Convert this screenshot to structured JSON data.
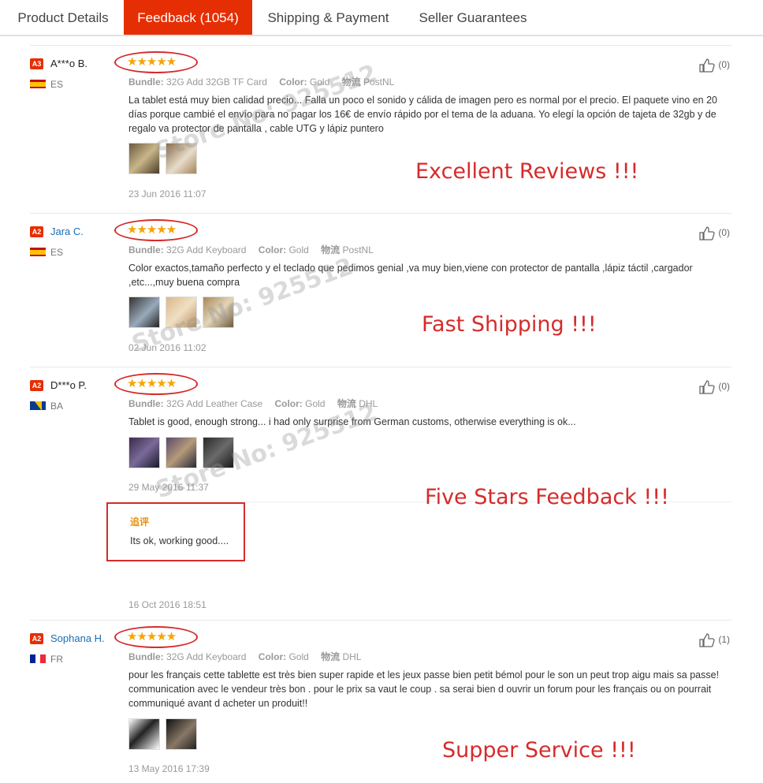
{
  "tabs": [
    {
      "label": "Product Details"
    },
    {
      "label": "Feedback (1054)"
    },
    {
      "label": "Shipping & Payment"
    },
    {
      "label": "Seller Guarantees"
    }
  ],
  "watermark": "Store No: 925512",
  "labels": {
    "bundle": "Bundle:",
    "color": "Color:",
    "logistics": "物流",
    "stars": "★★★★★"
  },
  "reviews": [
    {
      "level": "A3",
      "name": "A***o B.",
      "country": "ES",
      "bundle": "32G Add 32GB TF Card",
      "color": "Gold",
      "shipping": "PostNL",
      "text": "La tablet está muy bien calidad precio... Falla un poco el sonido y cálida de imagen pero es normal por el precio. El paquete vino en 20 días porque cambié el envío para no pagar los 16€ de envío rápido por el tema de la aduana. Yo elegí la opción de tajeta de 32gb y de regalo va protector de pantalla , cable UTG y lápiz puntero",
      "date": "23 Jun 2016 11:07",
      "likes": "(0)",
      "promo": "Excellent Reviews !!!"
    },
    {
      "level": "A2",
      "name": "Jara C.",
      "country": "ES",
      "bundle": "32G Add Keyboard",
      "color": "Gold",
      "shipping": "PostNL",
      "text": "Color exactos,tamaño perfecto y el teclado que pedimos genial ,va muy bien,viene con protector de pantalla ,lápiz táctil ,cargador ,etc...,muy buena compra",
      "date": "02 Jun 2016 11:02",
      "likes": "(0)",
      "promo": "Fast Shipping !!!"
    },
    {
      "level": "A2",
      "name": "D***o P.",
      "country": "BA",
      "bundle": "32G Add Leather Case",
      "color": "Gold",
      "shipping": "DHL",
      "text": "Tablet is good, enough strong... i had only surprise from German customs, otherwise everything is ok...",
      "date": "29 May 2016 11:37",
      "likes": "(0)",
      "promo": "Five Stars Feedback !!!",
      "followup": {
        "title": "追评",
        "text": "Its ok, working good....",
        "date": "16 Oct 2016 18:51"
      }
    },
    {
      "level": "A2",
      "name": "Sophana H.",
      "country": "FR",
      "bundle": "32G Add Keyboard",
      "color": "Gold",
      "shipping": "DHL",
      "text": "pour les français cette tablette est très bien super rapide et les jeux passe bien petit bémol pour le son un peut trop aigu mais sa passe! communication avec le vendeur très bon . pour le prix sa vaut le coup . sa serai bien d ouvrir un forum pour les français ou on pourrait communiqué avant d acheter un produit!!",
      "date": "13 May 2016 17:39",
      "likes": "(1)",
      "promo": "Supper Service !!!"
    }
  ]
}
